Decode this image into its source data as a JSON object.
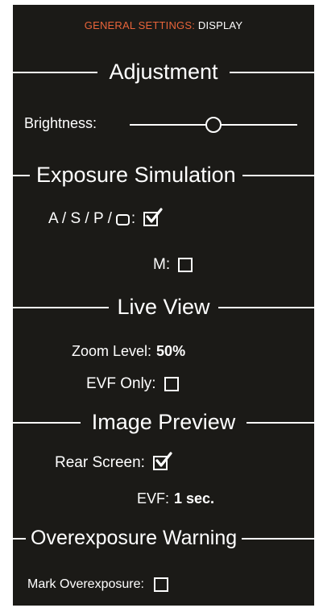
{
  "breadcrumb": {
    "section": "GENERAL SETTINGS:",
    "page": "DISPLAY"
  },
  "colors": {
    "accent": "#e8643a",
    "panel_bg": "#1b1a17",
    "text": "#ffffff"
  },
  "adjustment": {
    "title": "Adjustment",
    "brightness": {
      "label": "Brightness:",
      "level": 0.5
    }
  },
  "exposure_simulation": {
    "title": "Exposure Simulation",
    "asp": {
      "label": "A / S / P /",
      "suffix": ":",
      "icon": "rounded-square-mode-icon",
      "checked": true
    },
    "manual": {
      "label": "M:",
      "checked": false
    }
  },
  "live_view": {
    "title": "Live View",
    "zoom": {
      "label": "Zoom Level:",
      "value": "50%"
    },
    "evf_only": {
      "label": "EVF Only:",
      "checked": false
    }
  },
  "image_preview": {
    "title": "Image Preview",
    "rear_screen": {
      "label": "Rear Screen:",
      "checked": true
    },
    "evf": {
      "label": "EVF:",
      "value": "1 sec."
    }
  },
  "overexposure": {
    "title": "Overexposure Warning",
    "mark": {
      "label": "Mark Overexposure:",
      "checked": false
    }
  }
}
